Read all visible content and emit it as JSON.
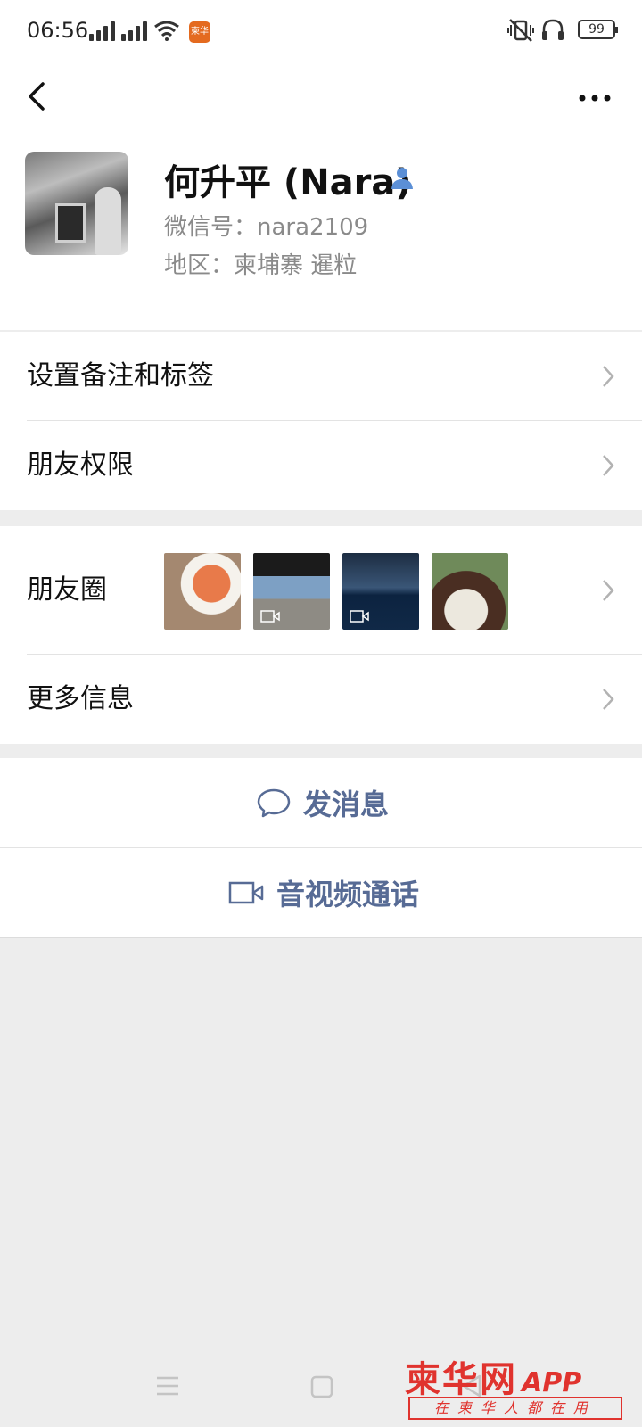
{
  "status_bar": {
    "time": "06:56",
    "battery": "99",
    "app_badge": "柬华网"
  },
  "profile": {
    "name": "何升平 (Nara)",
    "wechat_id": "微信号：nara2109",
    "region": "地区：柬埔寨  暹粒"
  },
  "menu": {
    "remarks_tags": "设置备注和标签",
    "friend_permissions": "朋友权限",
    "moments": "朋友圈",
    "more_info": "更多信息"
  },
  "actions": {
    "send_message": "发消息",
    "av_call": "音视频通话"
  },
  "moments_thumbnails": [
    {
      "kind": "photo"
    },
    {
      "kind": "video"
    },
    {
      "kind": "video"
    },
    {
      "kind": "photo"
    }
  ],
  "watermark": {
    "logo": "柬华网",
    "app": "APP",
    "slogan": "在柬华人都在用"
  },
  "colors": {
    "link_blue": "#576b95",
    "background": "#ededed",
    "watermark_red": "#e0332e"
  }
}
